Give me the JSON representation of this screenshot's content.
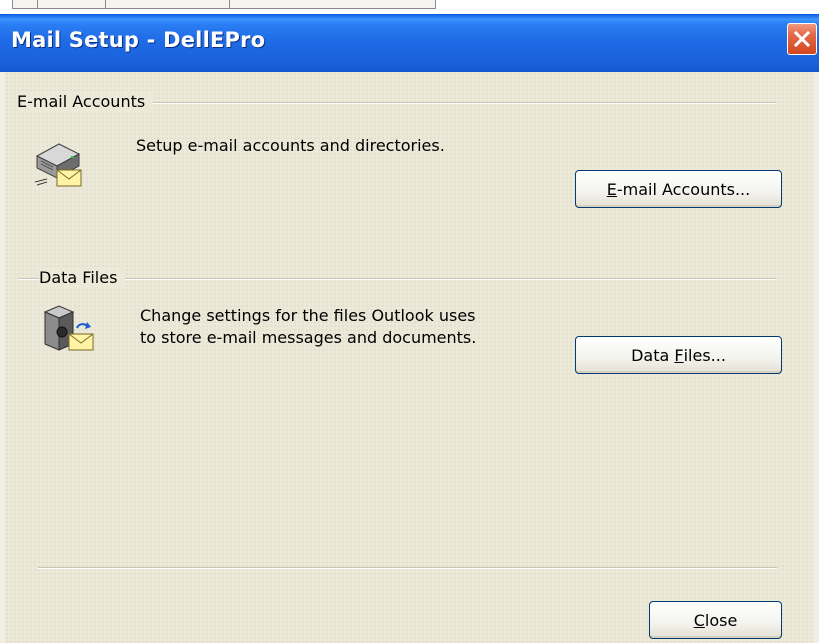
{
  "window": {
    "title": "Mail Setup - DellEPro"
  },
  "email_accounts": {
    "group_label": "E-mail Accounts",
    "description": "Setup e-mail accounts and directories.",
    "button": {
      "mnemonic": "E",
      "rest": "-mail Accounts..."
    }
  },
  "data_files": {
    "group_label": "Data Files",
    "description_line1": "Change settings for the files Outlook uses",
    "description_line2": "to store e-mail messages and documents.",
    "button": {
      "before": "Data ",
      "mnemonic": "F",
      "rest": "iles..."
    }
  },
  "footer": {
    "close_button": {
      "mnemonic": "C",
      "rest": "lose"
    }
  },
  "icons": {
    "close": "close-x-icon",
    "email_accounts": "mail-server-envelope-icon",
    "data_files": "data-file-envelope-icon"
  },
  "colors": {
    "titlebar": "#1f6ce6",
    "close_button": "#d4461f",
    "dialog_face": "#ece9d8",
    "button_border": "#003c74"
  }
}
